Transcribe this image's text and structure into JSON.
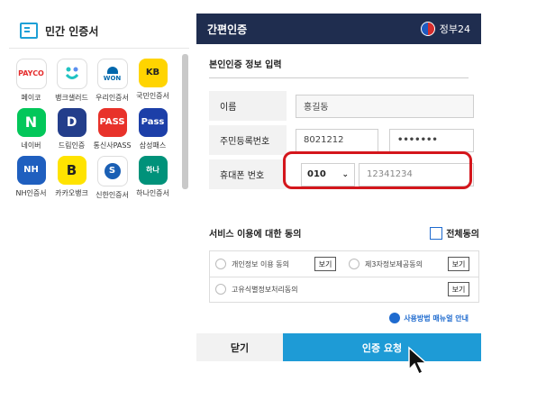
{
  "left_panel": {
    "title": "민간 인증서",
    "apps": [
      {
        "label": "페이코",
        "icon": "payco-icon",
        "text": "PAYCO",
        "bg": "#ffffff",
        "fg": "#e52c2c"
      },
      {
        "label": "뱅크샐러드",
        "icon": "banksalad-icon",
        "text": "",
        "bg": "#ffffff",
        "fg": "#20c3c3"
      },
      {
        "label": "우리인증서",
        "icon": "woori-icon",
        "text": "WON",
        "bg": "#ffffff",
        "fg": "#0067ac"
      },
      {
        "label": "국민인증서",
        "icon": "kb-icon",
        "text": "KB",
        "bg": "#ffd400",
        "fg": "#222222"
      },
      {
        "label": "네이버",
        "icon": "naver-icon",
        "text": "N",
        "bg": "#03c75a",
        "fg": "#ffffff"
      },
      {
        "label": "드림인증",
        "icon": "dream-icon",
        "text": "D",
        "bg": "#233e8b",
        "fg": "#ffffff"
      },
      {
        "label": "통신사PASS",
        "icon": "pass-icon",
        "text": "PASS",
        "bg": "#e8322a",
        "fg": "#ffffff"
      },
      {
        "label": "삼성패스",
        "icon": "samsung-pass-icon",
        "text": "Pass",
        "bg": "#1c3fa8",
        "fg": "#ffffff"
      },
      {
        "label": "NH인증서",
        "icon": "nh-icon",
        "text": "NH",
        "bg": "#1f5fbf",
        "fg": "#ffffff"
      },
      {
        "label": "카카오뱅크",
        "icon": "kakaobank-icon",
        "text": "B",
        "bg": "#ffe300",
        "fg": "#222222"
      },
      {
        "label": "신한인증서",
        "icon": "shinhan-icon",
        "text": "S",
        "bg": "#1a5fb4",
        "fg": "#ffffff"
      },
      {
        "label": "하나인증서",
        "icon": "hana-icon",
        "text": "하나",
        "bg": "#00927a",
        "fg": "#ffffff"
      }
    ]
  },
  "dialog": {
    "title": "간편인증",
    "brand": "정부24",
    "section_title": "본인인증 정보 입력",
    "name_label": "이름",
    "name_value": "홍길동",
    "rrn_label": "주민등록번호",
    "rrn_front": "8021212",
    "rrn_back": "•••••••",
    "phone_label": "휴대폰 번호",
    "phone_prefix": "010",
    "phone_number": "12341234",
    "agree_title": "서비스 이용에 대한 동의",
    "agree_all": "전체동의",
    "agree_items": [
      {
        "label": "개인정보 이용 동의",
        "view": "보기"
      },
      {
        "label": "제3자정보제공동의",
        "view": "보기"
      },
      {
        "label": "고유식별정보처리동의",
        "view": "보기"
      }
    ],
    "manual_link": "사용방법 매뉴얼 안내",
    "close_button": "닫기",
    "request_button": "인증 요청"
  },
  "colors": {
    "header_bg": "#1f2d4f",
    "accent": "#1e9bd6",
    "highlight": "#d4161c"
  }
}
